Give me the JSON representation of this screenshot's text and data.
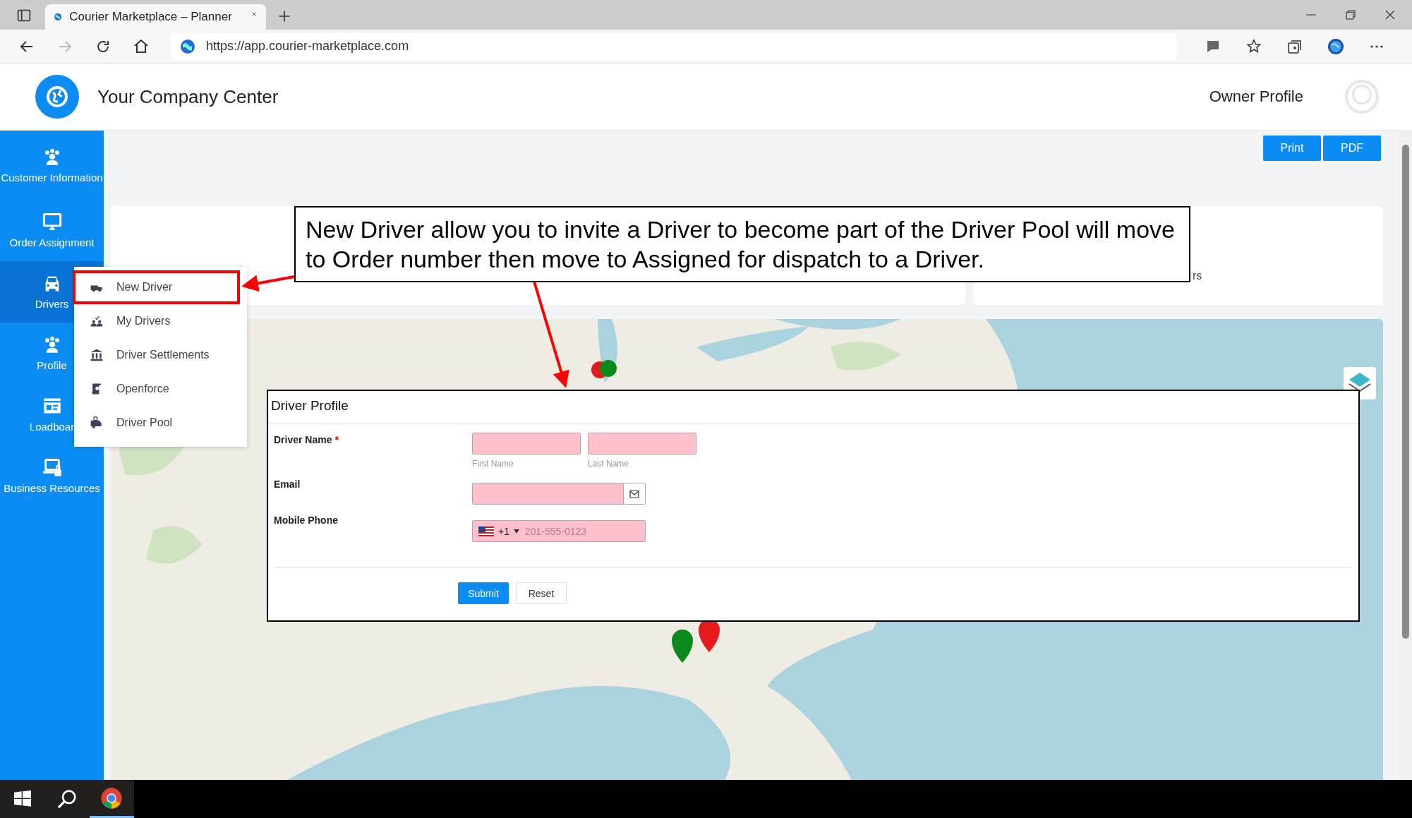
{
  "browser": {
    "tab_title": "Courier Marketplace – Planner",
    "url": "https://app.courier-marketplace.com"
  },
  "header": {
    "title": "Your Company Center",
    "profile_label": "Owner Profile"
  },
  "sidebar": {
    "items": [
      {
        "label": "Customer Information",
        "selected": false
      },
      {
        "label": "Order Assignment",
        "selected": false
      },
      {
        "label": "Drivers",
        "selected": true
      },
      {
        "label": "Profile",
        "selected": false
      },
      {
        "label": "Loadboar",
        "selected": false
      },
      {
        "label": "Business Resources",
        "selected": false
      }
    ]
  },
  "toolbar": {
    "buttons": [
      "Print",
      "PDF"
    ]
  },
  "summary_card": {
    "fragment": "rs"
  },
  "drivers_menu": {
    "items": [
      {
        "label": "New Driver",
        "selected": true
      },
      {
        "label": "My Drivers",
        "selected": false
      },
      {
        "label": "Driver Settlements",
        "selected": false
      },
      {
        "label": "Openforce",
        "selected": false
      },
      {
        "label": "Driver Pool",
        "selected": false
      }
    ]
  },
  "callout": {
    "text": "New Driver allow you to invite a Driver to become part of the Driver Pool will move to Order number then move to Assigned for dispatch to a Driver."
  },
  "form": {
    "title": "Driver Profile",
    "fields": [
      {
        "kind": "name",
        "label": "Driver Name",
        "required_mark": "*",
        "invalid": true,
        "hints": [
          "First Name",
          "Last Name"
        ]
      },
      {
        "kind": "email",
        "label": "Email",
        "invalid": true
      },
      {
        "kind": "phone",
        "label": "Mobile Phone",
        "invalid": true,
        "country_code": "+1",
        "placeholder": "201-555-0123"
      }
    ],
    "buttons": [
      {
        "label": "Submit",
        "kind": "primary"
      },
      {
        "label": "Reset",
        "kind": "secondary"
      }
    ]
  }
}
